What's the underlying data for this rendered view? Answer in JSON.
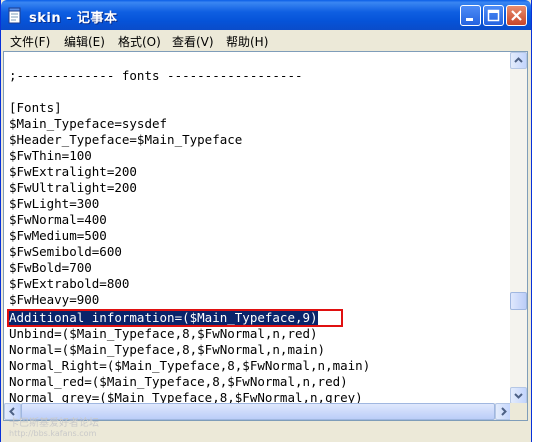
{
  "window": {
    "title": "skin - 记事本"
  },
  "menu": [
    {
      "label": "文件(F)"
    },
    {
      "label": "编辑(E)"
    },
    {
      "label": "格式(O)"
    },
    {
      "label": "查看(V)"
    },
    {
      "label": "帮助(H)"
    }
  ],
  "lines": [
    "",
    ";------------- fonts ------------------",
    "",
    "[Fonts]",
    "$Main_Typeface=sysdef",
    "$Header_Typeface=$Main_Typeface",
    "$FwThin=100",
    "$FwExtralight=200",
    "$FwUltralight=200",
    "$FwLight=300",
    "$FwNormal=400",
    "$FwMedium=500",
    "$FwSemibold=600",
    "$FwBold=700",
    "$FwExtrabold=800",
    "$FwHeavy=900",
    "Additional information=($Main_Typeface,9)",
    "Unbind=($Main_Typeface,8,$FwNormal,n,red)",
    "Normal=($Main_Typeface,8,$FwNormal,n,main)",
    "Normal_Right=($Main_Typeface,8,$FwNormal,n,main)",
    "Normal_red=($Main_Typeface,8,$FwNormal,n,red)",
    "Normal_grey=($Main_Typeface,8,$FwNormal,n,grey)"
  ],
  "watermark": {
    "line1": "卡巴斯基爱好者论坛",
    "line2": "http://bbs.kafans.com"
  },
  "colors": {
    "selection": "#0a246a",
    "highlight_border": "#e01010",
    "titlebar": "#0653d8"
  }
}
